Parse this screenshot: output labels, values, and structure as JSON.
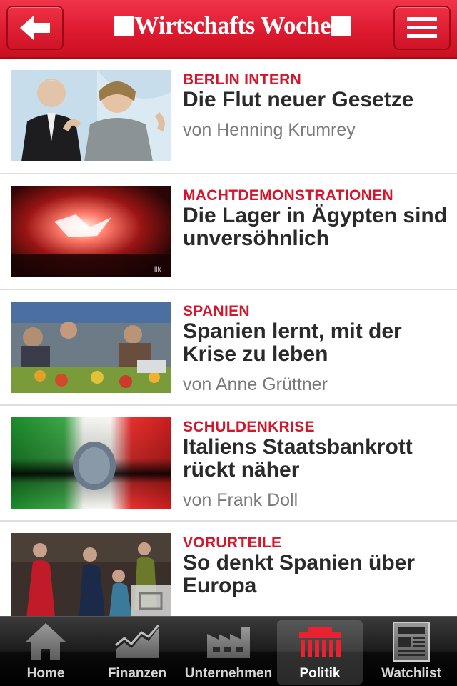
{
  "header": {
    "logo_text": "Wirtschafts Woche",
    "back_button": "back-arrow-icon",
    "menu_button": "hamburger-menu-icon",
    "brand_color": "#dd1a30"
  },
  "articles": [
    {
      "kicker": "BERLIN INTERN",
      "headline": "Die Flut neuer Gesetze",
      "author": "von Henning Krumrey"
    },
    {
      "kicker": "MACHTDEMONSTRATIONEN",
      "headline": "Die Lager in Ägypten sind unversöhnlich",
      "author": ""
    },
    {
      "kicker": "SPANIEN",
      "headline": "Spanien lernt, mit der Krise zu leben",
      "author": "von Anne Grüttner"
    },
    {
      "kicker": "SCHULDENKRISE",
      "headline": "Italiens Staatsbankrott rückt näher",
      "author": "von Frank Doll"
    },
    {
      "kicker": "VORURTEILE",
      "headline": "So denkt Spanien über Europa",
      "author": ""
    }
  ],
  "tabs": [
    {
      "label": "Home",
      "icon": "home-icon",
      "active": false
    },
    {
      "label": "Finanzen",
      "icon": "chart-icon",
      "active": false
    },
    {
      "label": "Unternehmen",
      "icon": "factory-icon",
      "active": false
    },
    {
      "label": "Politik",
      "icon": "parliament-icon",
      "active": true
    },
    {
      "label": "Watchlist",
      "icon": "newspaper-icon",
      "active": false
    }
  ],
  "colors": {
    "kicker": "#d4152a",
    "headline": "#2a2a2a",
    "author": "#7a7a7a"
  }
}
